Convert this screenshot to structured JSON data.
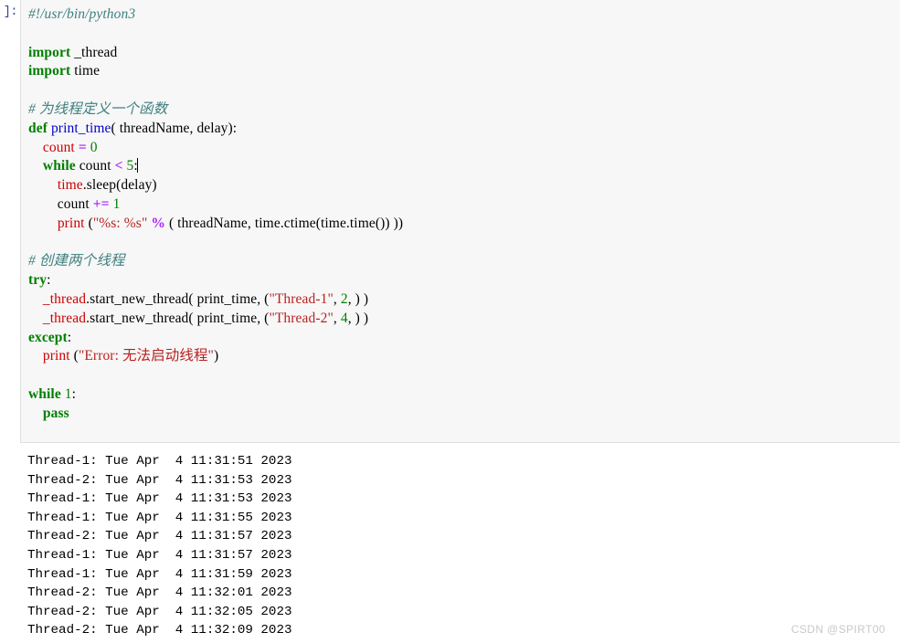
{
  "cell": {
    "prompt_label": "]:",
    "source_lines": [
      [
        {
          "t": "#!/usr/bin/python3",
          "c": "shebang"
        }
      ],
      [
        {
          "t": "",
          "c": "plain"
        }
      ],
      [
        {
          "t": "import",
          "c": "kw"
        },
        {
          "t": " _thread",
          "c": "plain"
        }
      ],
      [
        {
          "t": "import",
          "c": "kw"
        },
        {
          "t": " time",
          "c": "plain"
        }
      ],
      [
        {
          "t": "",
          "c": "plain"
        }
      ],
      [
        {
          "t": "# 为线程定义一个函数",
          "c": "cmt"
        }
      ],
      [
        {
          "t": "def",
          "c": "kw"
        },
        {
          "t": " ",
          "c": "plain"
        },
        {
          "t": "print_time",
          "c": "fn"
        },
        {
          "t": "( threadName, delay):",
          "c": "plain"
        }
      ],
      [
        {
          "t": "    ",
          "c": "plain"
        },
        {
          "t": "count",
          "c": "bi"
        },
        {
          "t": " ",
          "c": "plain"
        },
        {
          "t": "=",
          "c": "op"
        },
        {
          "t": " ",
          "c": "plain"
        },
        {
          "t": "0",
          "c": "num"
        }
      ],
      [
        {
          "t": "    ",
          "c": "plain"
        },
        {
          "t": "while",
          "c": "kw"
        },
        {
          "t": " count ",
          "c": "plain"
        },
        {
          "t": "<",
          "c": "op"
        },
        {
          "t": " ",
          "c": "plain"
        },
        {
          "t": "5",
          "c": "num"
        },
        {
          "t": ":",
          "c": "plain"
        },
        {
          "t": "|CARET|",
          "c": "caret"
        }
      ],
      [
        {
          "t": "        ",
          "c": "plain"
        },
        {
          "t": "time",
          "c": "bi"
        },
        {
          "t": ".sleep(delay)",
          "c": "plain"
        }
      ],
      [
        {
          "t": "        count ",
          "c": "plain"
        },
        {
          "t": "+=",
          "c": "op"
        },
        {
          "t": " ",
          "c": "plain"
        },
        {
          "t": "1",
          "c": "num"
        }
      ],
      [
        {
          "t": "        ",
          "c": "plain"
        },
        {
          "t": "print",
          "c": "bi"
        },
        {
          "t": " (",
          "c": "plain"
        },
        {
          "t": "\"%s: %s\"",
          "c": "str"
        },
        {
          "t": " ",
          "c": "plain"
        },
        {
          "t": "%",
          "c": "op"
        },
        {
          "t": " ( threadName, time.ctime(time.time()) ))",
          "c": "plain"
        }
      ],
      [
        {
          "t": "",
          "c": "plain"
        }
      ],
      [
        {
          "t": "# 创建两个线程",
          "c": "cmt"
        }
      ],
      [
        {
          "t": "try",
          "c": "kw"
        },
        {
          "t": ":",
          "c": "plain"
        }
      ],
      [
        {
          "t": "    ",
          "c": "plain"
        },
        {
          "t": "_thread",
          "c": "bi"
        },
        {
          "t": ".start_new_thread( print_time, (",
          "c": "plain"
        },
        {
          "t": "\"Thread-1\"",
          "c": "str"
        },
        {
          "t": ", ",
          "c": "plain"
        },
        {
          "t": "2",
          "c": "num"
        },
        {
          "t": ", ) )",
          "c": "plain"
        }
      ],
      [
        {
          "t": "    ",
          "c": "plain"
        },
        {
          "t": "_thread",
          "c": "bi"
        },
        {
          "t": ".start_new_thread( print_time, (",
          "c": "plain"
        },
        {
          "t": "\"Thread-2\"",
          "c": "str"
        },
        {
          "t": ", ",
          "c": "plain"
        },
        {
          "t": "4",
          "c": "num"
        },
        {
          "t": ", ) )",
          "c": "plain"
        }
      ],
      [
        {
          "t": "except",
          "c": "kw"
        },
        {
          "t": ":",
          "c": "plain"
        }
      ],
      [
        {
          "t": "    ",
          "c": "plain"
        },
        {
          "t": "print",
          "c": "bi"
        },
        {
          "t": " (",
          "c": "plain"
        },
        {
          "t": "\"Error: 无法启动线程\"",
          "c": "str"
        },
        {
          "t": ")",
          "c": "plain"
        }
      ],
      [
        {
          "t": "",
          "c": "plain"
        }
      ],
      [
        {
          "t": "while",
          "c": "kw"
        },
        {
          "t": " ",
          "c": "plain"
        },
        {
          "t": "1",
          "c": "num"
        },
        {
          "t": ":",
          "c": "plain"
        }
      ],
      [
        {
          "t": "    ",
          "c": "plain"
        },
        {
          "t": "pass",
          "c": "kw"
        }
      ]
    ]
  },
  "output": {
    "lines": [
      "Thread-1: Tue Apr  4 11:31:51 2023",
      "Thread-2: Tue Apr  4 11:31:53 2023",
      "Thread-1: Tue Apr  4 11:31:53 2023",
      "Thread-1: Tue Apr  4 11:31:55 2023",
      "Thread-2: Tue Apr  4 11:31:57 2023",
      "Thread-1: Tue Apr  4 11:31:57 2023",
      "Thread-1: Tue Apr  4 11:31:59 2023",
      "Thread-2: Tue Apr  4 11:32:01 2023",
      "Thread-2: Tue Apr  4 11:32:05 2023",
      "Thread-2: Tue Apr  4 11:32:09 2023"
    ]
  },
  "watermark": {
    "text": "CSDN @SPIRT00"
  },
  "colors": {
    "cell_background": "#f7f7f7",
    "cell_border": "#dfdfdf",
    "prompt": "#303f9f",
    "keyword": "#008000",
    "function_name": "#0000cc",
    "builtin": "#cc0000",
    "string": "#ba2121",
    "number": "#008000",
    "operator": "#aa22ff",
    "comment": "#408080",
    "watermark": "#c9c9c9"
  }
}
